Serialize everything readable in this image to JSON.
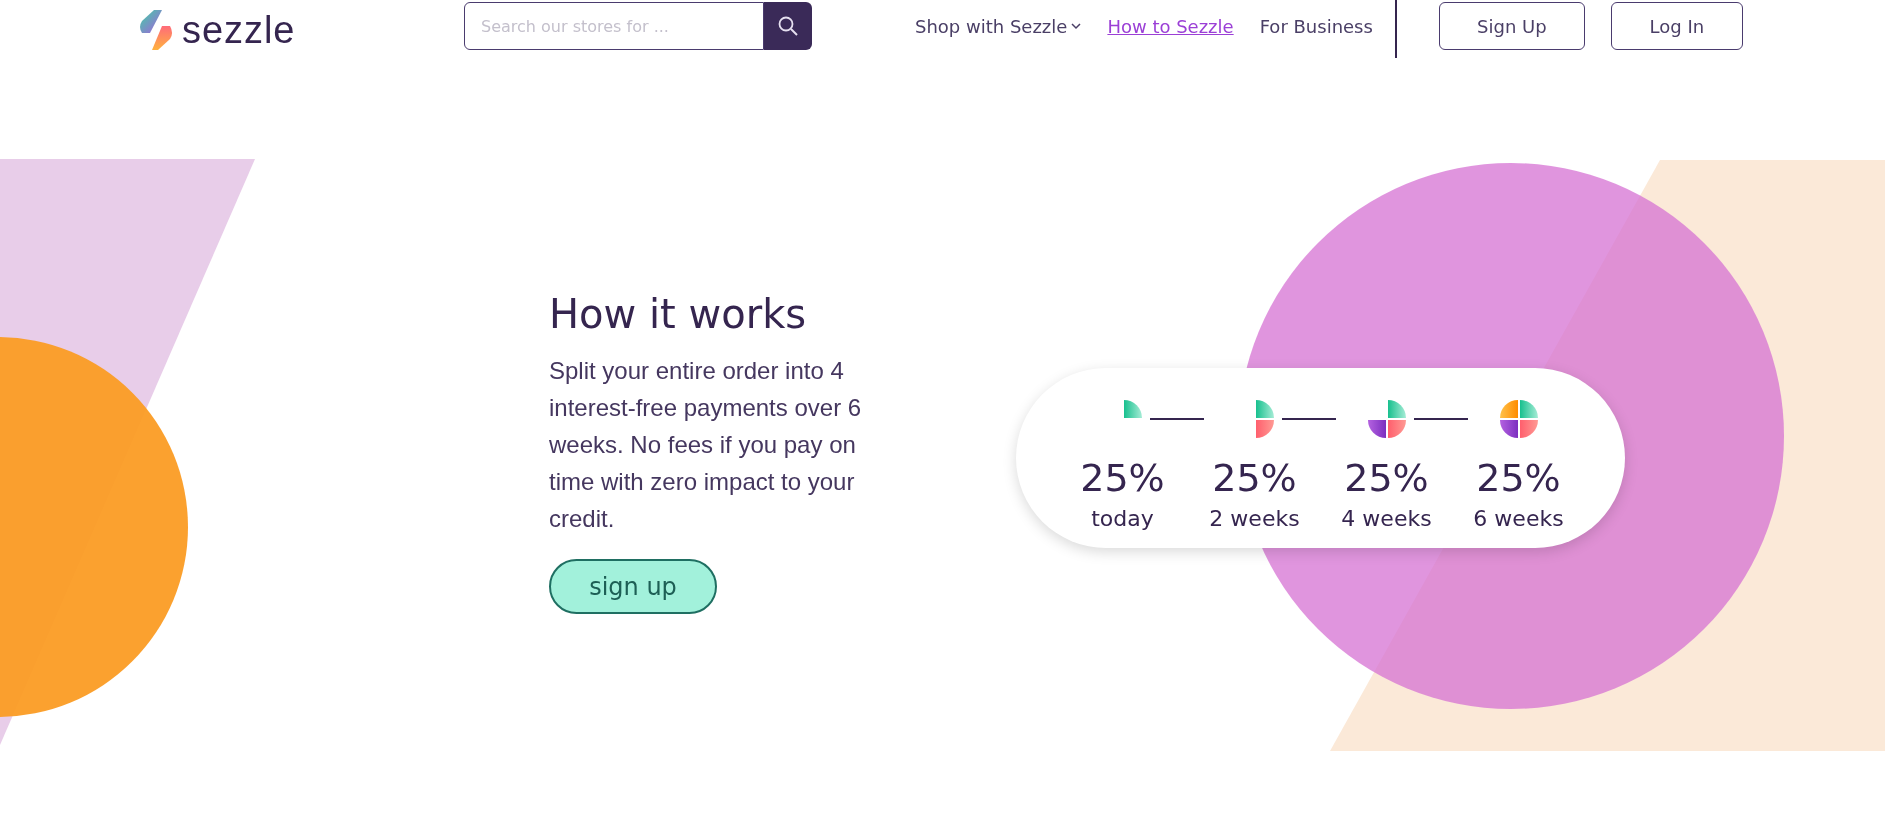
{
  "header": {
    "logo": "sezzle",
    "search": {
      "placeholder": "Search our stores for ..."
    },
    "nav": [
      {
        "label": "Shop with Sezzle",
        "kind": "dropdown",
        "selected": false
      },
      {
        "label": "How to Sezzle",
        "kind": "link",
        "selected": true
      },
      {
        "label": "For Business",
        "kind": "link",
        "selected": false
      }
    ],
    "buttons": [
      "Sign Up",
      "Log In"
    ]
  },
  "hero": {
    "title": "How it works",
    "text": "Split your entire order into 4 interest-free payments over 6 weeks. No fees if you pay on time with zero impact to your credit.",
    "button": "sign up",
    "steps": [
      {
        "percent": "25%",
        "when": "today"
      },
      {
        "percent": "25%",
        "when": "2 weeks"
      },
      {
        "percent": "25%",
        "when": "4 weeks"
      },
      {
        "percent": "25%",
        "when": "6 weeks"
      }
    ]
  }
}
